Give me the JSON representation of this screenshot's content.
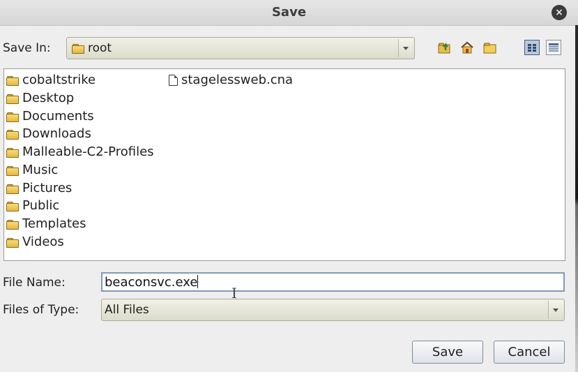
{
  "window": {
    "title": "Save",
    "close_icon": "×"
  },
  "save_in": {
    "label": "Save In:",
    "value": "root"
  },
  "toolbar": {
    "icons": [
      "up-folder-icon",
      "home-folder-icon",
      "new-folder-icon",
      "list-view-icon",
      "details-view-icon"
    ]
  },
  "files": {
    "folders": [
      "cobaltstrike",
      "Desktop",
      "Documents",
      "Downloads",
      "Malleable-C2-Profiles",
      "Music",
      "Pictures",
      "Public",
      "Templates",
      "Videos"
    ],
    "documents": [
      "stagelessweb.cna"
    ]
  },
  "file_name": {
    "label": "File Name:",
    "value": "beaconsvc.exe"
  },
  "files_of_type": {
    "label": "Files of Type:",
    "value": "All Files"
  },
  "buttons": {
    "save": "Save",
    "cancel": "Cancel"
  },
  "colors": {
    "folder": "#e7b843",
    "selected_view": "#b9c9dc",
    "field_border": "#7f9bb8"
  }
}
